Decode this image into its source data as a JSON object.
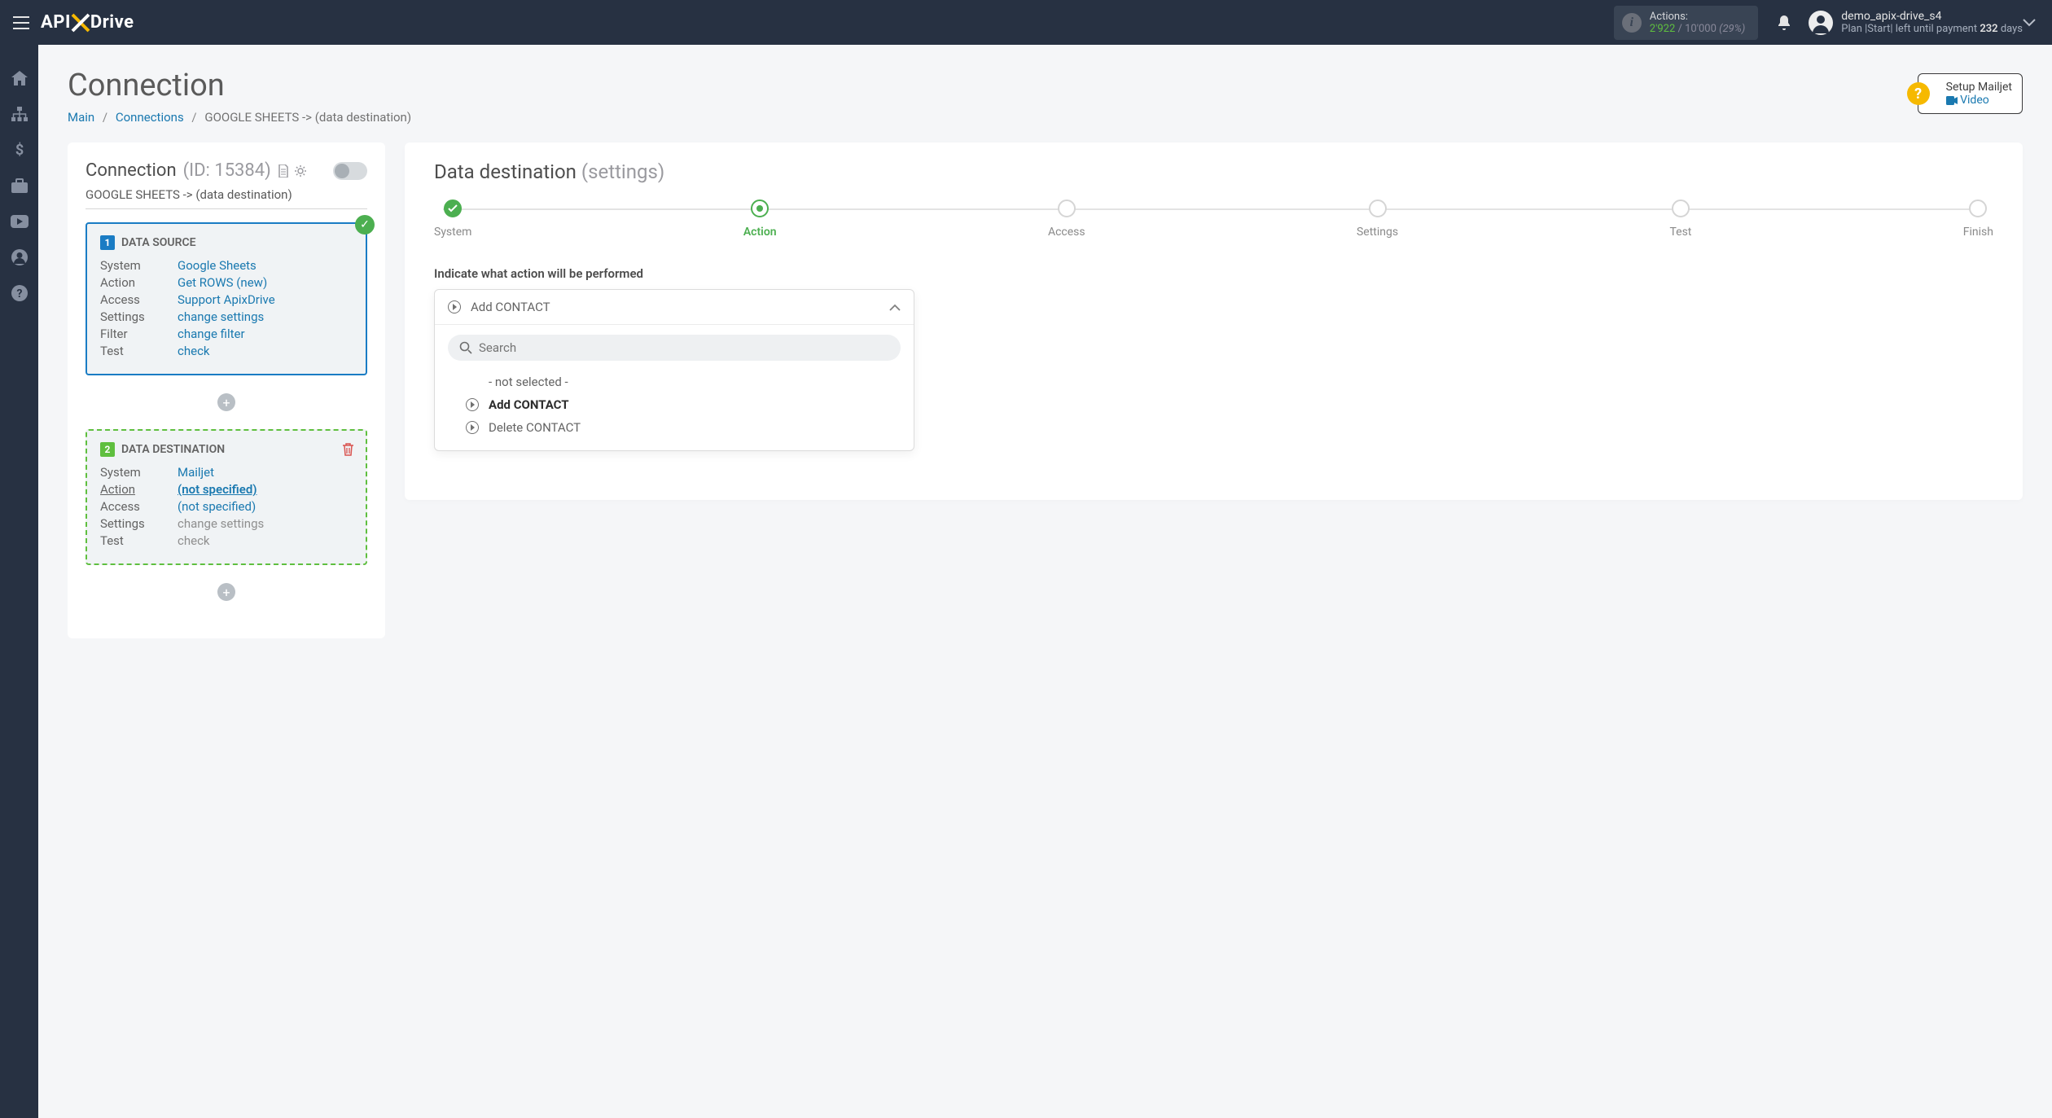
{
  "header": {
    "actions_label": "Actions:",
    "actions_used": "2'922",
    "actions_total": "10'000",
    "actions_pct": "(29%)",
    "user_name": "demo_apix-drive_s4",
    "plan_prefix": "Plan ",
    "plan_name": "|Start|",
    "plan_suffix": " left until payment ",
    "days": "232",
    "days_word": " days"
  },
  "page": {
    "title": "Connection",
    "breadcrumb": {
      "main": "Main",
      "connections": "Connections",
      "current": "GOOGLE SHEETS -> (data destination)"
    }
  },
  "help": {
    "title": "Setup Mailjet",
    "link": "Video"
  },
  "left": {
    "title": "Connection",
    "id_text": "(ID: 15384)",
    "conn_name": "GOOGLE SHEETS -> (data destination)",
    "source": {
      "heading": "DATA SOURCE",
      "rows": [
        {
          "label": "System",
          "value": "Google Sheets"
        },
        {
          "label": "Action",
          "value": "Get ROWS (new)"
        },
        {
          "label": "Access",
          "value": "Support ApixDrive"
        },
        {
          "label": "Settings",
          "value": "change settings"
        },
        {
          "label": "Filter",
          "value": "change filter"
        },
        {
          "label": "Test",
          "value": "check"
        }
      ]
    },
    "dest": {
      "heading": "DATA DESTINATION",
      "rows": [
        {
          "label": "System",
          "value": "Mailjet",
          "type": "link"
        },
        {
          "label": "Action",
          "value": "(not specified)",
          "type": "bold"
        },
        {
          "label": "Access",
          "value": "(not specified)",
          "type": "link"
        },
        {
          "label": "Settings",
          "value": "change settings",
          "type": "gray"
        },
        {
          "label": "Test",
          "value": "check",
          "type": "gray"
        }
      ]
    }
  },
  "right": {
    "title": "Data destination",
    "subtitle": "(settings)",
    "steps": [
      "System",
      "Action",
      "Access",
      "Settings",
      "Test",
      "Finish"
    ],
    "prompt": "Indicate what action will be performed",
    "dropdown": {
      "selected": "Add CONTACT",
      "search_placeholder": "Search",
      "options": [
        {
          "text": "- not selected -",
          "no_icon": true
        },
        {
          "text": "Add CONTACT",
          "selected": true
        },
        {
          "text": "Delete CONTACT"
        }
      ]
    }
  }
}
